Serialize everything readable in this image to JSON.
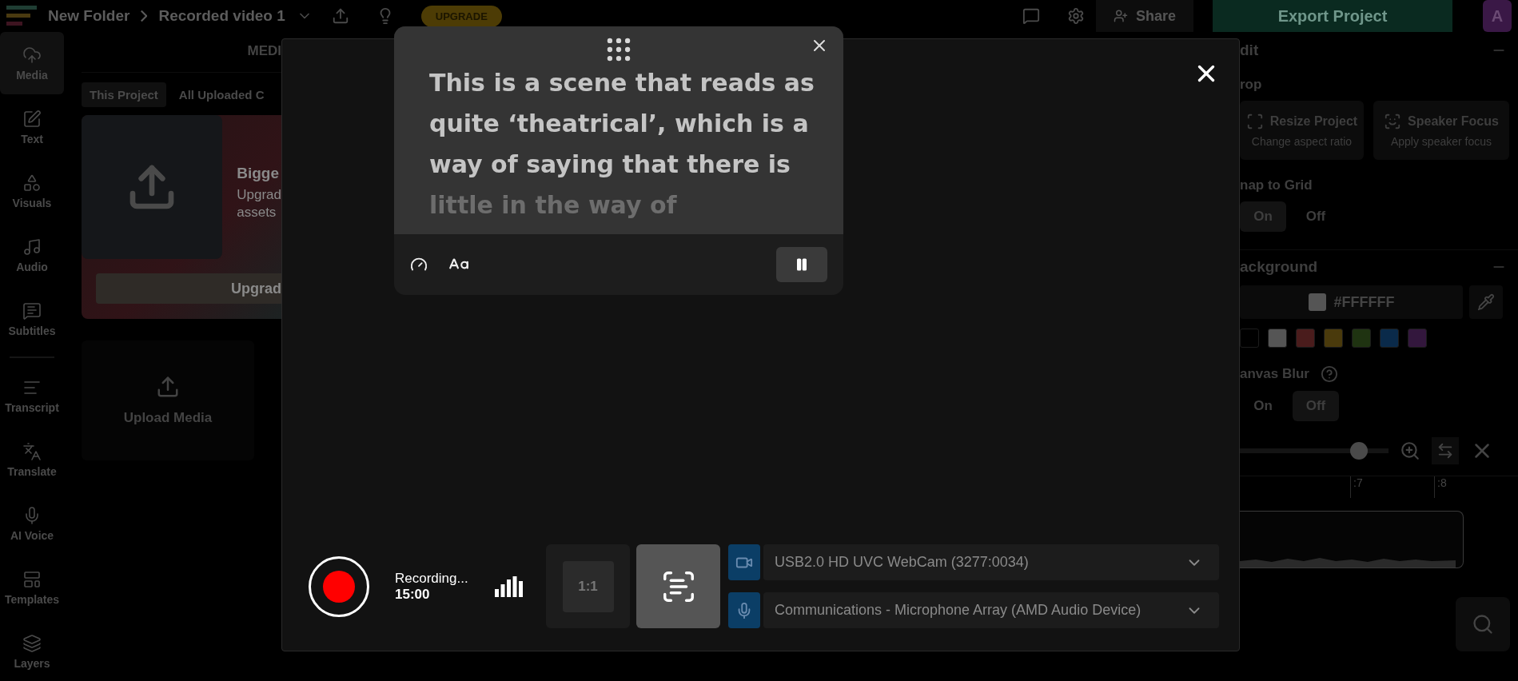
{
  "top_bar": {
    "breadcrumb": [
      "New Folder",
      "Recorded video 1"
    ],
    "upgrade": "UPGRADE",
    "share": "Share",
    "export": "Export Project",
    "avatar": "A"
  },
  "sidebar": {
    "groups": [
      [
        {
          "label": "Media",
          "selected": true
        },
        {
          "label": "Text",
          "selected": false
        },
        {
          "label": "Visuals",
          "selected": false
        },
        {
          "label": "Audio",
          "selected": false
        },
        {
          "label": "Subtitles",
          "selected": false
        }
      ],
      [
        {
          "label": "Transcript",
          "selected": false
        },
        {
          "label": "Translate",
          "selected": false
        },
        {
          "label": "AI Voice",
          "selected": false
        },
        {
          "label": "Templates",
          "selected": false
        },
        {
          "label": "Layers",
          "selected": false
        }
      ]
    ]
  },
  "media_panel": {
    "title": "MEDI",
    "tabs": [
      {
        "label": "This Project",
        "selected": true
      },
      {
        "label": "All Uploaded C",
        "selected": false
      }
    ],
    "promo": {
      "title": "Bigge",
      "lines": [
        "Upgrad",
        "assets"
      ],
      "button": "Upgrad"
    },
    "upload": "Upload Media"
  },
  "recorder": {
    "teleprompter": {
      "text": "This is a scene that reads as quite ‘theatrical’, which is a way of saying that there is little in the way of"
    },
    "status": "Recording...",
    "time": "15:00",
    "ratio": "1:1",
    "devices": [
      {
        "kind": "camera",
        "name": "USB2.0 HD UVC WebCam (3277:0034)"
      },
      {
        "kind": "microphone",
        "name": "Communications - Microphone Array (AMD Audio Device)"
      }
    ]
  },
  "right_panel": {
    "title": "dit",
    "crop_label": "rop",
    "crop_actions": [
      {
        "title": "Resize Project",
        "subtitle": "Change aspect ratio"
      },
      {
        "title": "Speaker Focus",
        "subtitle": "Apply speaker focus"
      }
    ],
    "snap": {
      "label": "nap to Grid",
      "options": [
        {
          "label": "On",
          "selected": true
        },
        {
          "label": "Off",
          "selected": false
        }
      ]
    },
    "background": {
      "title": "ackground",
      "value": "#FFFFFF",
      "swatches": [
        {
          "color": "#000000"
        },
        {
          "color": "#555555"
        },
        {
          "color": "#4a1c1c"
        },
        {
          "color": "#4a3a0c"
        },
        {
          "color": "#1f3311"
        },
        {
          "color": "#0a2a4a"
        },
        {
          "color": "#33173d"
        }
      ]
    },
    "blur": {
      "label": "anvas Blur",
      "options": [
        {
          "label": "On",
          "selected": false
        },
        {
          "label": "Off",
          "selected": true
        }
      ]
    }
  },
  "timeline": {
    "zoom": {
      "level": 0.8
    },
    "ticks": [
      ":7",
      ":8"
    ]
  }
}
